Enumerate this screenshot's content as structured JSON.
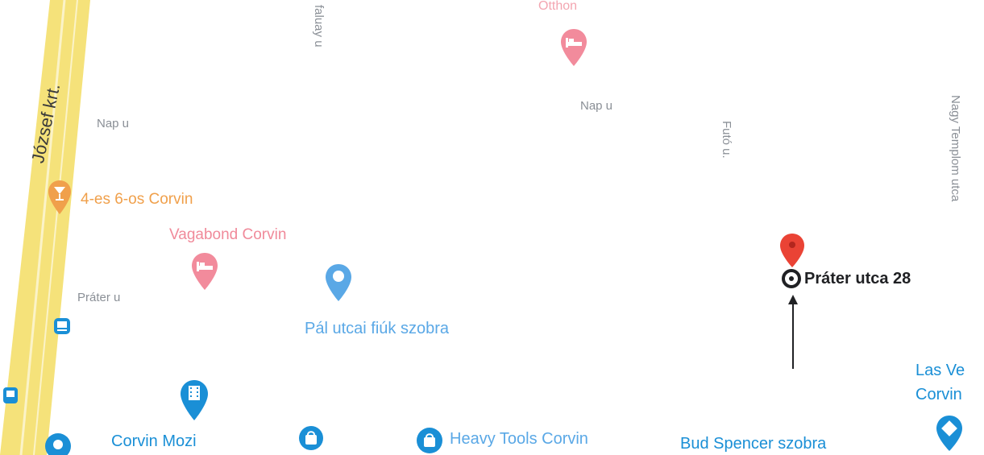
{
  "map": {
    "streets": {
      "jozsef": "József krt.",
      "nap_west": "Nap u",
      "nap_east": "Nap u",
      "prater": "Práter u",
      "faluby": "faluay u",
      "futo": "Futó u.",
      "nagy_templom": "Nagy Templom utca"
    },
    "pois": {
      "bar": "4-es 6-os Corvin",
      "vagabond": "Vagabond Corvin",
      "pal_utcai": "Pál utcai fiúk szobra",
      "corvin_mozi": "Corvin Mozi",
      "heavy_tools": "Heavy Tools Corvin",
      "bud_spencer": "Bud Spencer szobra",
      "las_vegas_1": "Las Ve",
      "las_vegas_2": "Corvin",
      "top_hotel": "Otthon"
    },
    "selected": {
      "address": "Práter utca 28"
    },
    "colors": {
      "road_major": "#f5e27a",
      "pin_red": "#ea4335",
      "pin_pink": "#f28b9c",
      "pin_blue": "#1a8fd6",
      "pin_orange": "#f0a04b"
    },
    "icons": [
      "cocktail-icon",
      "bed-icon",
      "camera-icon",
      "film-icon",
      "shopping-bag-icon",
      "bus-icon",
      "location-target-icon",
      "arrow-up-icon"
    ]
  }
}
